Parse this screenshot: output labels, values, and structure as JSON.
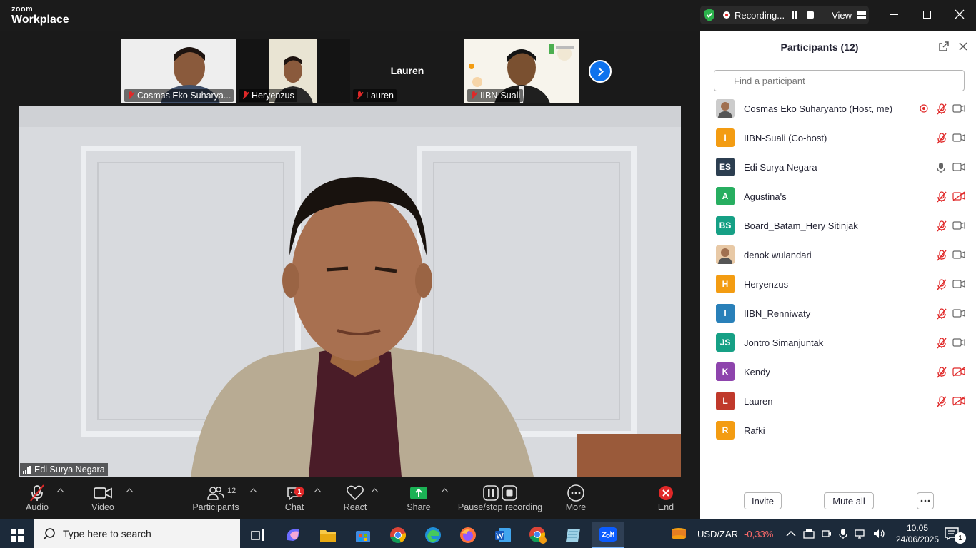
{
  "title_bar": {
    "brand_top": "zoom",
    "brand_main": "Workplace",
    "recording_label": "Recording...",
    "view_label": "View"
  },
  "thumbnails": [
    {
      "name": "Cosmas Eko Suharya..."
    },
    {
      "name": "Heryenzus"
    },
    {
      "name": "Lauren",
      "center_name": "Lauren"
    },
    {
      "name": "IIBN-Suali"
    }
  ],
  "main_video": {
    "speaker_name": "Edi Surya Negara"
  },
  "toolbar": {
    "audio": "Audio",
    "video": "Video",
    "participants": "Participants",
    "participants_count": "12",
    "chat": "Chat",
    "chat_badge": "1",
    "react": "React",
    "share": "Share",
    "recording": "Pause/stop recording",
    "more": "More",
    "end": "End"
  },
  "panel": {
    "title": "Participants (12)",
    "search_placeholder": "Find a participant",
    "invite": "Invite",
    "mute_all": "Mute all",
    "participants": [
      {
        "initials": "",
        "name": "Cosmas Eko Suharyanto (Host, me)",
        "color": "#cccccc",
        "photo": true,
        "mic": "muted",
        "cam": "on",
        "recording": true
      },
      {
        "initials": "I",
        "name": "IIBN-Suali (Co-host)",
        "color": "#f39c12",
        "mic": "muted",
        "cam": "on"
      },
      {
        "initials": "ES",
        "name": "Edi Surya Negara",
        "color": "#2c3e50",
        "mic": "on",
        "cam": "on"
      },
      {
        "initials": "A",
        "name": "Agustina's",
        "color": "#27ae60",
        "mic": "muted",
        "cam": "off"
      },
      {
        "initials": "BS",
        "name": "Board_Batam_Hery Sitinjak",
        "color": "#16a085",
        "mic": "muted",
        "cam": "on"
      },
      {
        "initials": "",
        "name": "denok wulandari",
        "color": "#e8c9a6",
        "photo": true,
        "mic": "muted",
        "cam": "on"
      },
      {
        "initials": "H",
        "name": "Heryenzus",
        "color": "#f39c12",
        "mic": "muted",
        "cam": "on"
      },
      {
        "initials": "I",
        "name": "IIBN_Renniwaty",
        "color": "#2980b9",
        "mic": "muted",
        "cam": "on"
      },
      {
        "initials": "JS",
        "name": "Jontro Simanjuntak",
        "color": "#16a085",
        "mic": "muted",
        "cam": "on"
      },
      {
        "initials": "K",
        "name": "Kendy",
        "color": "#8e44ad",
        "mic": "muted",
        "cam": "off"
      },
      {
        "initials": "L",
        "name": "Lauren",
        "color": "#c0392b",
        "mic": "muted",
        "cam": "off"
      },
      {
        "initials": "R",
        "name": "Rafki",
        "color": "#f39c12",
        "mic": "none",
        "cam": "none"
      }
    ]
  },
  "taskbar": {
    "search_placeholder": "Type here to search",
    "ticker_symbol": "USD/ZAR",
    "ticker_change": "-0,33%",
    "time": "10.05",
    "date": "24/06/2025",
    "notification_count": "1"
  },
  "colors": {
    "accent": "#0e72ed",
    "muted_red": "#e02828",
    "share_green": "#1bb255",
    "recording_shield": "#2bb24c"
  }
}
